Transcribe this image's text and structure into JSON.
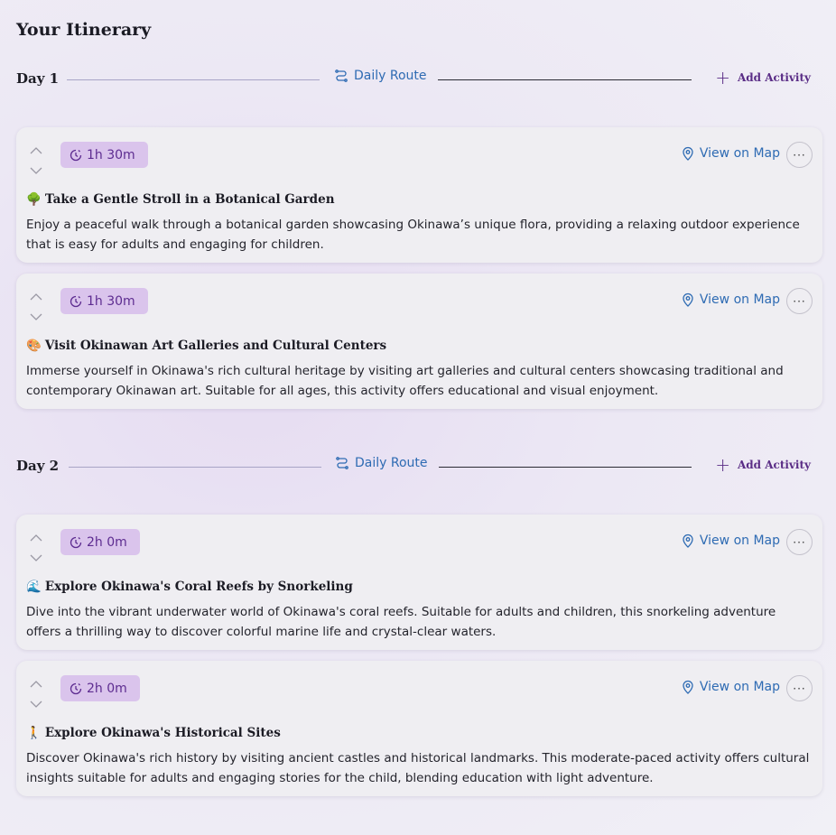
{
  "page": {
    "title": "Your Itinerary"
  },
  "days": [
    {
      "label": "Day 1",
      "route_label": "Daily Route",
      "add_label": "Add Activity",
      "activities": [
        {
          "duration": "1h 30m",
          "emoji": "🌳",
          "title": "Take a Gentle Stroll in a Botanical Garden",
          "description": "Enjoy a peaceful walk through a botanical garden showcasing Okinawa’s unique flora, providing a relaxing outdoor experience that is easy for adults and engaging for children.",
          "map_label": "View on Map"
        },
        {
          "duration": "1h 30m",
          "emoji": "🎨",
          "title": "Visit Okinawan Art Galleries and Cultural Centers",
          "description": "Immerse yourself in Okinawa's rich cultural heritage by visiting art galleries and cultural centers showcasing traditional and contemporary Okinawan art. Suitable for all ages, this activity offers educational and visual enjoyment.",
          "map_label": "View on Map"
        }
      ]
    },
    {
      "label": "Day 2",
      "route_label": "Daily Route",
      "add_label": "Add Activity",
      "activities": [
        {
          "duration": "2h 0m",
          "emoji": "🌊",
          "title": "Explore Okinawa's Coral Reefs by Snorkeling",
          "description": "Dive into the vibrant underwater world of Okinawa's coral reefs. Suitable for adults and children, this snorkeling adventure offers a thrilling way to discover colorful marine life and crystal-clear waters.",
          "map_label": "View on Map"
        },
        {
          "duration": "2h 0m",
          "emoji": "🚶",
          "title": "Explore Okinawa's Historical Sites",
          "description": "Discover Okinawa's rich history by visiting ancient castles and historical landmarks. This moderate-paced activity offers cultural insights suitable for adults and engaging stories for the child, blending education with light adventure.",
          "map_label": "View on Map"
        }
      ]
    }
  ],
  "icons": {
    "route": "route-icon",
    "plus": "plus-icon",
    "duration": "clock-icon",
    "map": "map-pin-icon",
    "more": "more-options-icon",
    "move_up": "chevron-up-icon",
    "move_down": "chevron-down-icon"
  },
  "colors": {
    "accent_purple": "#5d2c90",
    "duration_badge_bg": "#dac4ec",
    "link_blue": "#2e6bb3"
  }
}
